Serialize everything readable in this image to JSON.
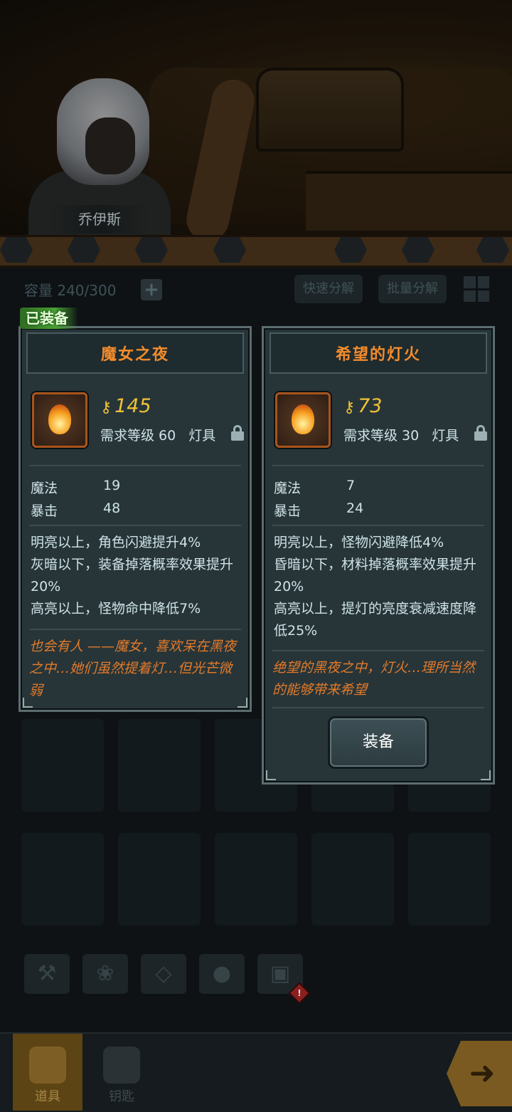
{
  "scene": {
    "hero_name": "乔伊斯"
  },
  "inventory": {
    "capacity_label": "容量 240/300",
    "expand_icon": "plus-icon",
    "quick_dismantle_label": "快速分解",
    "batch_dismantle_label": "批量分解",
    "layout_toggle_icon": "grid-icon"
  },
  "equipped_card": {
    "equipped_tag": "已装备",
    "title": "魔女之夜",
    "power": "145",
    "key_icon": "key-icon",
    "required_level": "需求等级 60",
    "item_type": "灯具",
    "stats": [
      {
        "label": "魔法",
        "value": "19"
      },
      {
        "label": "暴击",
        "value": "48"
      }
    ],
    "effects": [
      "明亮以上，角色闪避提升4%",
      "灰暗以下，装备掉落概率效果提升20%",
      "高亮以上，怪物命中降低7%"
    ],
    "lore": "也会有人 ——魔女，喜欢呆在黑夜之中…她们虽然提着灯…但光芒微弱"
  },
  "compare_card": {
    "title": "希望的灯火",
    "power": "73",
    "key_icon": "key-icon",
    "required_level": "需求等级 30",
    "item_type": "灯具",
    "stats": [
      {
        "label": "魔法",
        "value": "7"
      },
      {
        "label": "暴击",
        "value": "24"
      }
    ],
    "effects": [
      "明亮以上，怪物闪避降低4%",
      "昏暗以下，材料掉落概率效果提升20%",
      "高亮以上，提灯的亮度衰减速度降低25%"
    ],
    "lore": "绝望的黑夜之中，灯火…理所当然的能够带来希望",
    "equip_button": "装备"
  },
  "filter_bar": [
    {
      "icon": "weapon-icon"
    },
    {
      "icon": "paw-icon"
    },
    {
      "icon": "gem-icon"
    },
    {
      "icon": "ore-icon"
    },
    {
      "icon": "chest-icon"
    }
  ],
  "bottom_nav": {
    "tabs": [
      {
        "label": "道具",
        "icon": "backpack-icon",
        "active": true
      },
      {
        "label": "钥匙",
        "icon": "key-icon",
        "active": false
      }
    ],
    "next_icon": "arrow-right-icon"
  },
  "colors": {
    "accent_orange": "#f28c2c",
    "power_gold": "#f1c237",
    "equipped_green": "#4aa335",
    "card_bg": "#273539"
  }
}
